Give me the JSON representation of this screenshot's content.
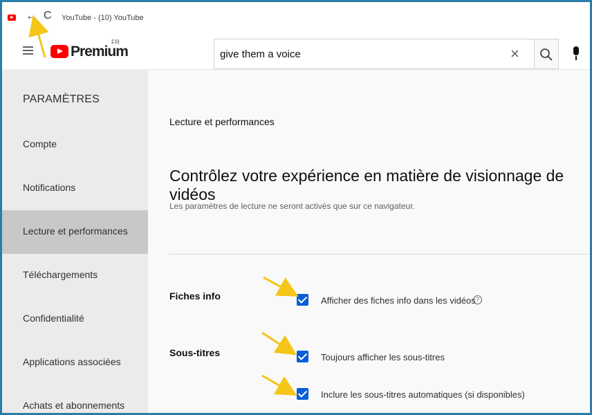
{
  "browser": {
    "tab_title": "YouTube - (10) YouTube",
    "back_glyph": "←",
    "reload_glyph": "C"
  },
  "header": {
    "logo_text": "Premium",
    "country_code": "FR",
    "search_value": "give them a voice",
    "clear_glyph": "×"
  },
  "sidebar": {
    "title": "PARAMÈTRES",
    "items": [
      {
        "label": "Compte"
      },
      {
        "label": "Notifications"
      },
      {
        "label": "Lecture et performances"
      },
      {
        "label": "Téléchargements"
      },
      {
        "label": "Confidentialité"
      },
      {
        "label": "Applications associées"
      },
      {
        "label": "Achats et abonnements"
      }
    ],
    "active_index": 2
  },
  "main": {
    "section_title": "Lecture et performances",
    "heading": "Contrôlez votre expérience en matière de visionnage de vidéos",
    "subheading": "Les paramètres de lecture ne seront activés que sur ce navigateur.",
    "info_cards": {
      "label": "Fiches info",
      "option": "Afficher des fiches info dans les vidéos",
      "checked": true,
      "help_glyph": "?"
    },
    "subtitles": {
      "label": "Sous-titres",
      "options": [
        {
          "label": "Toujours afficher les sous-titres",
          "checked": true
        },
        {
          "label": "Inclure les sous-titres automatiques (si disponibles)",
          "checked": true
        }
      ]
    }
  },
  "colors": {
    "accent": "#065fd4",
    "brand": "#ff0000",
    "annotation": "#f5c518",
    "frame": "#2a7da8"
  }
}
